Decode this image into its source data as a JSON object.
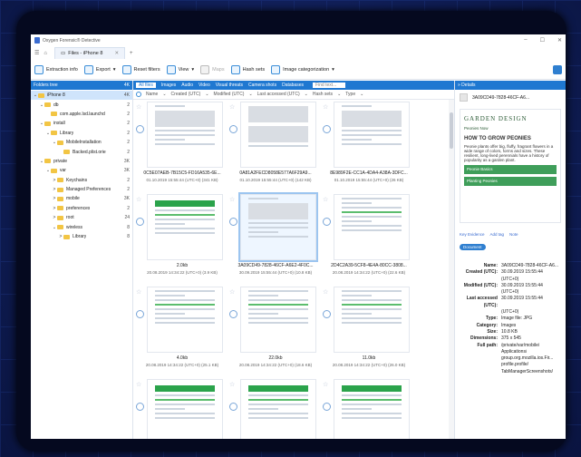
{
  "window": {
    "title": "Oxygen Forensic® Detective"
  },
  "tab": {
    "label": "Files - iPhone 8"
  },
  "toolbar": {
    "extraction_info": "Extraction info",
    "export": "Export",
    "reset_filters": "Reset filters",
    "view": "View",
    "maps": "Maps",
    "hash_sets": "Hash sets",
    "image_categorization": "Image categorization"
  },
  "folders": {
    "header": "Folders tree",
    "header_count": "4K",
    "items": [
      {
        "name": "iPhone 8",
        "count": "4K",
        "level": 0,
        "chev": "⌄",
        "selected": true
      },
      {
        "name": "db",
        "count": "2",
        "level": 1,
        "chev": "⌄"
      },
      {
        "name": "com.apple.lsd.launchd",
        "count": "2",
        "level": 2,
        "chev": ""
      },
      {
        "name": "install",
        "count": "2",
        "level": 1,
        "chev": "⌄"
      },
      {
        "name": "Library",
        "count": "2",
        "level": 2,
        "chev": "⌄"
      },
      {
        "name": "MobileInstallation",
        "count": "2",
        "level": 3,
        "chev": "⌄"
      },
      {
        "name": "Backed.plist.orie",
        "count": "2",
        "level": 4,
        "chev": ""
      },
      {
        "name": "private",
        "count": "3K",
        "level": 1,
        "chev": "⌄"
      },
      {
        "name": "var",
        "count": "3K",
        "level": 2,
        "chev": "⌄"
      },
      {
        "name": "Keychains",
        "count": "2",
        "level": 3,
        "chev": ">"
      },
      {
        "name": "Managed Preferences",
        "count": "2",
        "level": 3,
        "chev": ">"
      },
      {
        "name": "mobile",
        "count": "3K",
        "level": 3,
        "chev": ">"
      },
      {
        "name": "preferences",
        "count": "2",
        "level": 3,
        "chev": ">"
      },
      {
        "name": "root",
        "count": "24",
        "level": 3,
        "chev": ">"
      },
      {
        "name": "wireless",
        "count": "8",
        "level": 3,
        "chev": "⌄"
      },
      {
        "name": "Library",
        "count": "8",
        "level": 4,
        "chev": ">"
      }
    ]
  },
  "center": {
    "tabs": [
      "All files",
      "Images",
      "Audio",
      "Video",
      "Visual threats",
      "Camera shots",
      "Databases",
      "Find text..."
    ],
    "columns": [
      "Name",
      "Created (UTC)",
      "Modified (UTC)",
      "Last accessed (UTC)",
      "Hash sets",
      "Type"
    ],
    "cells": [
      {
        "name": "0C5E07AEB-7B15C5-FD16A535-6E...",
        "date": "01.10.2019 15:55:44 (UTC+0) (341 KB)",
        "kind": "a"
      },
      {
        "name": "0A81A2FECD8058E577A6F29A9...",
        "date": "01.10.2019 15:55:44 (UTC+0) (142 KB)",
        "kind": "b"
      },
      {
        "name": "8E989F2E-CC1A-4DA4-A38A-3DFC...",
        "date": "01.10.2019 15:55:44 (UTC+0) (26 KB)",
        "kind": "c"
      },
      {
        "name": "2.0kb",
        "date": "20.08.2019 14:34:22 (UTC+0) (3.9 KB)",
        "kind": "d"
      },
      {
        "name": "3A09CD49-7828-46CF-A6E2-4F0C...",
        "date": "30.09.2019 15:55:44 (UTC+0) (10.8 KB)",
        "kind": "e",
        "sel": true
      },
      {
        "name": "2D4C2A39-5CF8-4E4A-80CC-3808...",
        "date": "20.08.2019 14:34:22 (UTC+0) (22.6 KB)",
        "kind": "f"
      },
      {
        "name": "4.0kb",
        "date": "20.08.2019 14:34:22 (UTC+0) (25.1 KB)",
        "kind": "g"
      },
      {
        "name": "22.0kb",
        "date": "20.08.2019 14:34:22 (UTC+0) (18.6 KB)",
        "kind": "h"
      },
      {
        "name": "11.0kb",
        "date": "20.08.2019 14:34:22 (UTC+0) (26.0 KB)",
        "kind": "i"
      },
      {
        "name": "17.0kb",
        "date": "20.08.2019 14:34:22 (UTC+0) (22.0 KB)",
        "kind": "j"
      },
      {
        "name": "15.0kb",
        "date": "20.08.2019 14:34:22 (UTC+0) (16.2 KB)",
        "kind": "k"
      },
      {
        "name": "17.0kb",
        "date": "20.08.2019 14:34:22 (UTC+0) (22.8 KB)",
        "kind": "l"
      }
    ]
  },
  "details": {
    "header": "Details",
    "file_title": "3A09CD49-7828-46CF-A6...",
    "preview": {
      "brand": "GARDEN DESIGN",
      "link1": "Peonies Now",
      "heading": "HOW TO GROW PEONIES",
      "body": "Peonie plants offer big, fluffy, fragrant flowers in a wide range of colors, forms and sizes. These resilient, long-lived perennials have a history of popularity as a garden plant.",
      "btn1": "Peonie Basics",
      "btn2": "Planting Peonies"
    },
    "links": [
      "Key Evidence",
      "Add tag",
      "Note"
    ],
    "badge": "Document",
    "props": [
      {
        "k": "Name:",
        "v": "3A09CD49-7828-46CF-A6..."
      },
      {
        "k": "Created (UTC):",
        "v": "30.09.2019 15:55:44"
      },
      {
        "k": "",
        "v": "(UTC+0)"
      },
      {
        "k": "Modified (UTC):",
        "v": "30.09.2019 15:55:44"
      },
      {
        "k": "",
        "v": "(UTC+0)"
      },
      {
        "k": "Last accessed (UTC):",
        "v": "30.09.2019 15:55:44"
      },
      {
        "k": "",
        "v": "(UTC+0)"
      },
      {
        "k": "Type:",
        "v": "Image file: JPG"
      },
      {
        "k": "Category:",
        "v": "Images"
      },
      {
        "k": "Size:",
        "v": "10.8 KB"
      },
      {
        "k": "Dimensions:",
        "v": "375 x 545"
      },
      {
        "k": "Full path:",
        "v": "/private/var/mobile/"
      },
      {
        "k": "",
        "v": "Applications/"
      },
      {
        "k": "",
        "v": "group.org.mozilla.ios.Fir..."
      },
      {
        "k": "",
        "v": "profile.profile/"
      },
      {
        "k": "",
        "v": "TabManagerScreenshots/"
      }
    ]
  }
}
